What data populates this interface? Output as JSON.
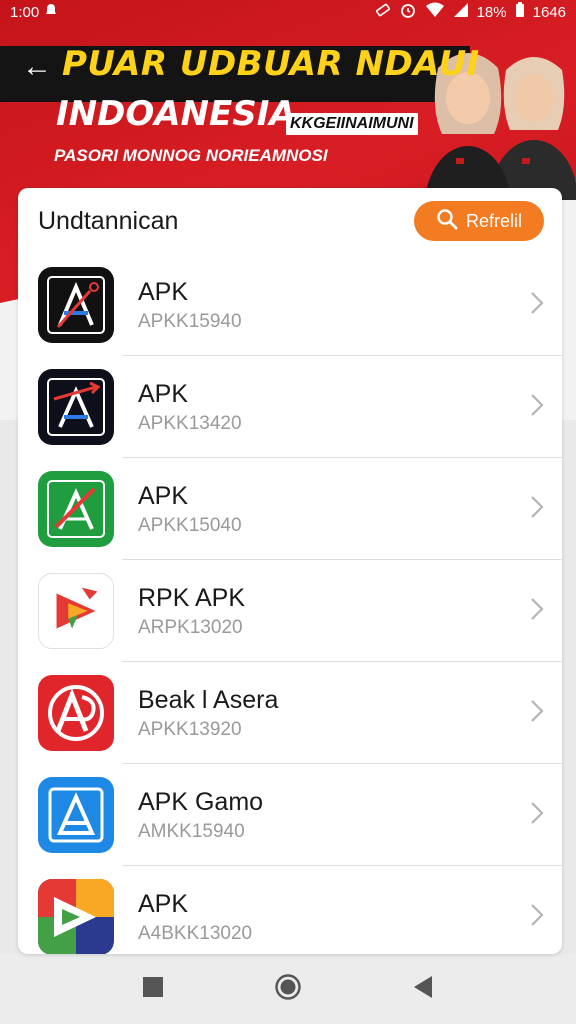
{
  "status_bar": {
    "time": "1:00",
    "battery": "18%",
    "clock_right": "1646"
  },
  "banner": {
    "title": "PUAR UDBUAR NDAUI",
    "subtitle": "INDOANESIA",
    "tag": "KKGEIINAIMUNI",
    "strap": "PASORI MONNOG NORIEAMNOSI"
  },
  "card": {
    "title": "Undtannican",
    "refresh_label": "Refrelil"
  },
  "apps": [
    {
      "name": "APK",
      "code": "APKK15940",
      "icon": "apk-a-icon-black-red"
    },
    {
      "name": "APK",
      "code": "APKK13420",
      "icon": "apk-a-icon-black-arrow"
    },
    {
      "name": "APK",
      "code": "APKK15040",
      "icon": "apk-a-icon-green"
    },
    {
      "name": "RPK APK",
      "code": "ARPK13020",
      "icon": "apk-play-icon-white"
    },
    {
      "name": "Beak l Asera",
      "code": "APKK13920",
      "icon": "apk-a-icon-red"
    },
    {
      "name": "APK Gamo",
      "code": "AMKK15940",
      "icon": "apk-a-icon-blue"
    },
    {
      "name": "APK",
      "code": "A4BKK13020",
      "icon": "apk-play-icon-multicolor"
    }
  ],
  "colors": {
    "accent": "#f37b21",
    "banner_red": "#d81e24",
    "banner_yellow": "#ffd21a"
  }
}
